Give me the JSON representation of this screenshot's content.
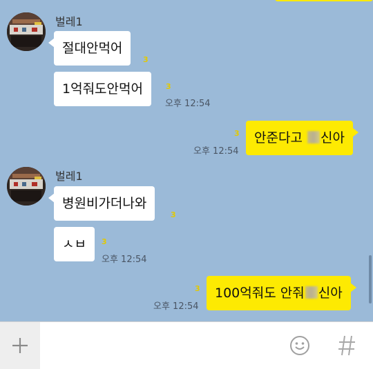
{
  "messages_group1": {
    "sender": "벌레1",
    "msg1": "절대안먹어",
    "msg1_unread": "3",
    "msg2": "1억줘도안먹어",
    "msg2_unread": "3",
    "time": "오후 12:54"
  },
  "my_msg1": {
    "text_before": "안준다고",
    "text_after": "신아",
    "unread": "3",
    "time": "오후 12:54"
  },
  "messages_group2": {
    "sender": "벌레1",
    "msg1": "병원비가더나와",
    "msg1_unread": "3",
    "msg2": "ㅅㅂ",
    "msg2_unread": "3",
    "time": "오후 12:54"
  },
  "my_msg2": {
    "text_before": "100억줘도 안줘",
    "text_after": "신아",
    "unread": "3",
    "time": "오후 12:54"
  },
  "input_bar": {
    "placeholder": "",
    "plus_icon": "plus-icon",
    "emoji_icon": "smiley-icon",
    "hash_icon": "hash-icon"
  },
  "colors": {
    "background": "#9bbad8",
    "my_bubble": "#fdea02",
    "their_bubble": "#ffffff",
    "unread": "#e2c903"
  }
}
